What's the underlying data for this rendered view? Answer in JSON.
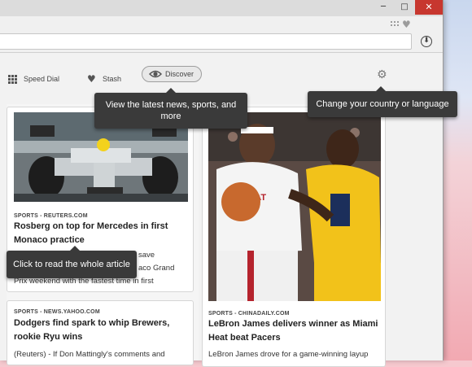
{
  "window": {
    "minimize_glyph": "─",
    "maximize_glyph": "□",
    "close_glyph": "✕"
  },
  "toolbar": {
    "download_glyph": "⬇"
  },
  "nav": {
    "speed_dial_label": "Speed Dial",
    "stash_label": "Stash",
    "discover_label": "Discover",
    "settings_icon": "gear-icon"
  },
  "tooltips": {
    "discover": "View the latest news, sports, and more",
    "country": "Change your country or language",
    "article": "Click to read the whole article"
  },
  "articles": [
    {
      "source": "SPORTS - REUTERS.COM",
      "headline": "Rosberg on top for Mercedes in first Monaco practice",
      "snippet_line1": "save",
      "snippet_line2": "aco Grand",
      "snippet_line3": "Prix weekend with the fastest time in first"
    },
    {
      "source": "SPORTS - NEWS.YAHOO.COM",
      "headline": "Dodgers find spark to whip Brewers, rookie Ryu wins",
      "snippet": "(Reuters) - If Don Mattingly's comments and"
    },
    {
      "source": "SPORTS - CHINADAILY.COM",
      "headline": "LeBron James delivers winner as Miami Heat beat Pacers",
      "snippet": "LeBron James drove for a game-winning layup"
    }
  ],
  "colors": {
    "tooltip_bg": "#3a3a3a",
    "close_button": "#c7372f",
    "heat_jersey": "#ffffff",
    "pacers_jersey": "#f2c21a"
  }
}
